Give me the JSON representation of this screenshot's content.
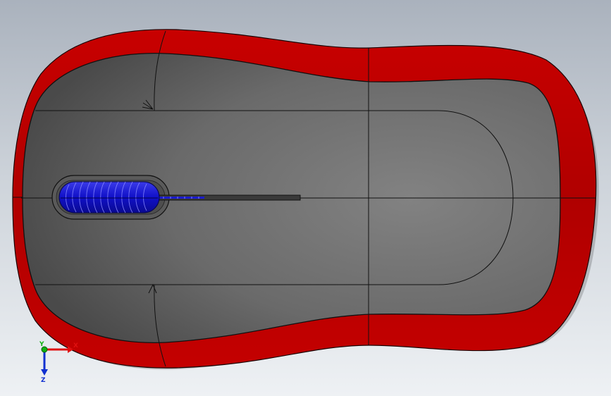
{
  "viewport": {
    "model": "computer-mouse-top-view",
    "colors": {
      "shell": "#c40000",
      "shell_edge": "#6e0000",
      "top_surface": "#6e6e6e",
      "scroll_wheel": "#1a1acc",
      "background_top": "#aab2bd",
      "background_bottom": "#eef1f4"
    }
  },
  "triad": {
    "x_label": "X",
    "y_label": "Y",
    "z_label": "Z",
    "colors": {
      "x": "#e01010",
      "y": "#10b010",
      "z": "#1030d0"
    }
  }
}
